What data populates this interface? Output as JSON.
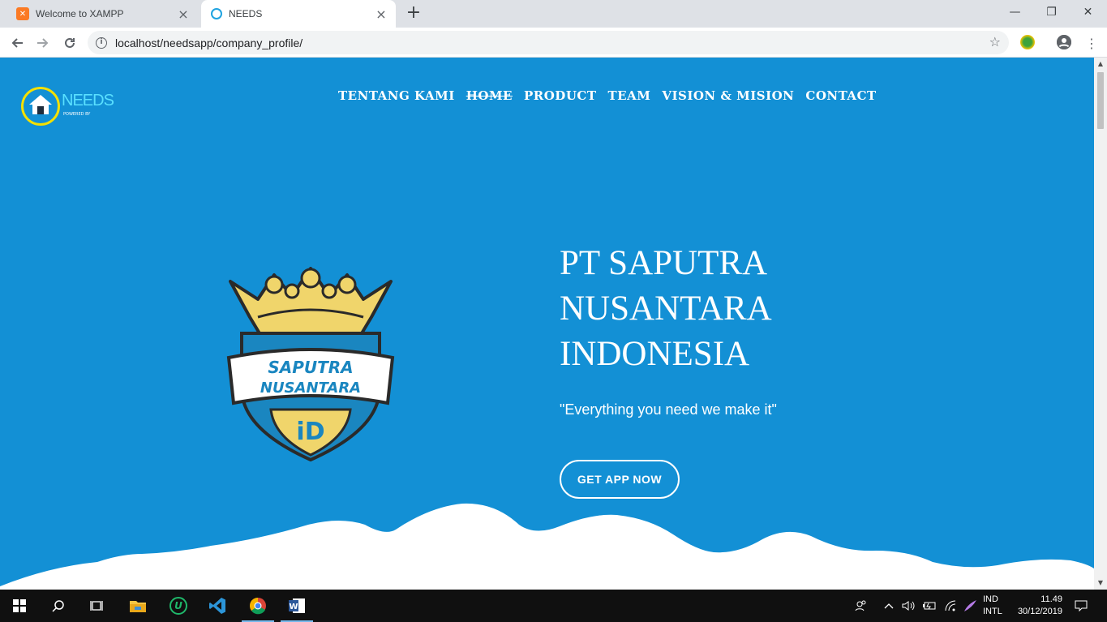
{
  "browser": {
    "tabs": [
      {
        "title": "Welcome to XAMPP",
        "icon": "xampp-icon",
        "active": false
      },
      {
        "title": "NEEDS",
        "icon": "needs-icon",
        "active": true
      }
    ],
    "address": "localhost/needsapp/company_profile/"
  },
  "site": {
    "logo": {
      "brand": "NEEDS",
      "powered": "POWERED BY"
    },
    "nav": [
      "TENTANG KAMI",
      "HOME",
      "PRODUCT",
      "TEAM",
      "VISION & MISION",
      "CONTACT"
    ],
    "crest": {
      "line1": "SAPUTRA",
      "line2": "NUSANTARA",
      "mark": "iD"
    },
    "hero": {
      "title_lines": [
        "PT SAPUTRA",
        "NUSANTARA",
        "INDONESIA"
      ],
      "tagline": "\"Everything you need we make it\"",
      "cta": "GET APP NOW"
    },
    "colors": {
      "background": "#1390d5",
      "crest_gold": "#f0d56b",
      "wave": "#ffffff"
    }
  },
  "taskbar": {
    "language": [
      "IND",
      "INTL"
    ],
    "time": "11.49",
    "date": "30/12/2019"
  }
}
